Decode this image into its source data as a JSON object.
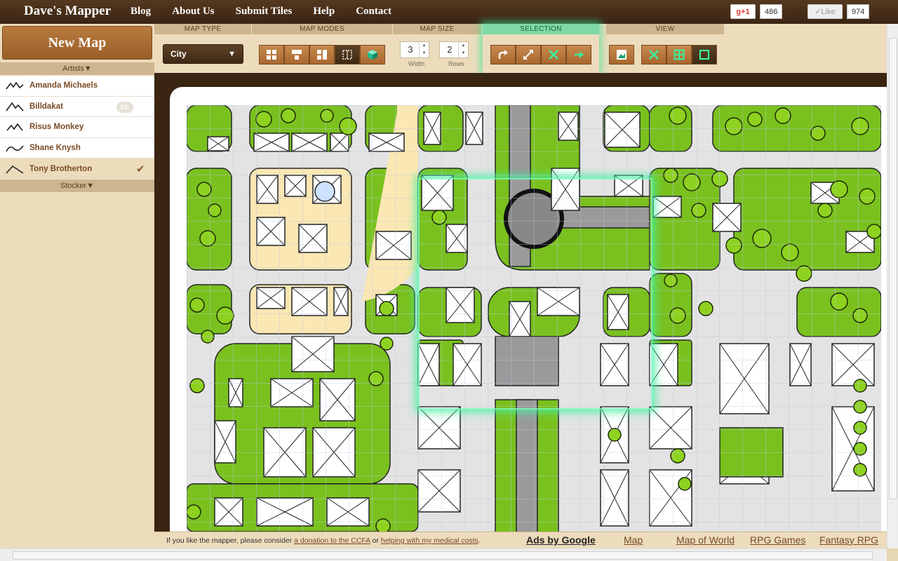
{
  "brand": "Dave's Mapper",
  "nav": [
    "Blog",
    "About Us",
    "Submit Tiles",
    "Help",
    "Contact"
  ],
  "social": {
    "gplus_label": "+1",
    "gplus_count": "486",
    "like_label": "Like",
    "like_count": "974"
  },
  "sidebar": {
    "new_map": "New Map",
    "artists_head": "Artists▼",
    "artists": [
      {
        "name": "Amanda Michaels",
        "badge": "",
        "selected": false
      },
      {
        "name": "Billdakat",
        "badge": "EC",
        "selected": false
      },
      {
        "name": "Risus Monkey",
        "badge": "",
        "selected": false
      },
      {
        "name": "Shane Knysh",
        "badge": "",
        "selected": false
      },
      {
        "name": "Tony Brotherton",
        "badge": "",
        "selected": true
      }
    ],
    "stocker_head": "Stocker▼",
    "check_glyph": "✔"
  },
  "toolbar": {
    "map_type_label": "MAP TYPE",
    "map_type_value": "City",
    "map_type_arrow": "▼",
    "map_modes_label": "MAP MODES",
    "map_size_label": "MAP SIZE",
    "width_value": "3",
    "rows_value": "2",
    "width_label": "Width",
    "rows_label": "Rows",
    "spin_up": "▲",
    "spin_down": "▼",
    "selection_label": "SELECTION",
    "view_label": "VIEW"
  },
  "footer": {
    "donate_prefix": "If you like the mapper, please consider ",
    "donate_link1": "a donation to the CCFA",
    "donate_mid": " or ",
    "donate_link2": "helping with my medical costs",
    "donate_suffix": ".",
    "ads": "Ads by Google",
    "links": [
      "Map",
      "Map of World",
      "RPG Games",
      "Fantasy RPG"
    ]
  },
  "colors": {
    "green": "#7ac11f",
    "road": "#e3e3e3",
    "building": "#ffffff",
    "sand": "#fbe7b3",
    "accent": "#3ae8a0",
    "brown": "#3a2412"
  }
}
